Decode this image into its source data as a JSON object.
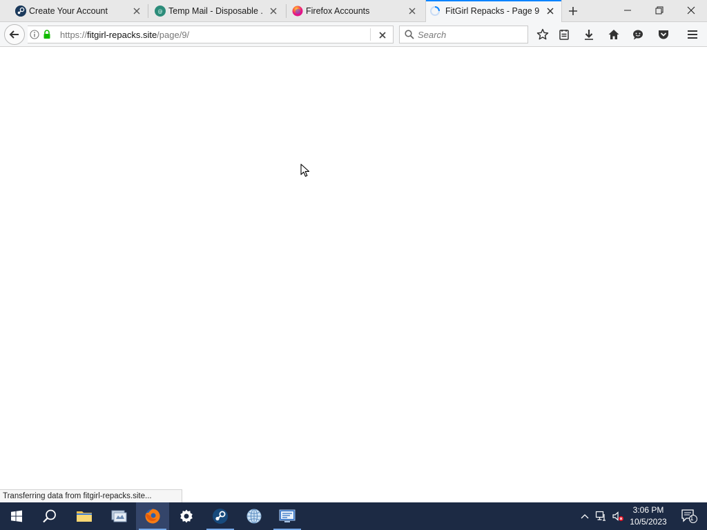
{
  "tabs": [
    {
      "title": "Create Your Account",
      "favicon": "steam-icon"
    },
    {
      "title": "Temp Mail - Disposable ...",
      "favicon": "tempmail-icon"
    },
    {
      "title": "Firefox Accounts",
      "favicon": "firefox-icon"
    },
    {
      "title": "FitGirl Repacks - Page 9 ...",
      "favicon": "loading-spinner-icon",
      "active": true
    }
  ],
  "address_bar": {
    "url_prefix": "https://",
    "url_host": "fitgirl-repacks.site",
    "url_path": "/page/9/"
  },
  "search_bar": {
    "placeholder": "Search",
    "value": ""
  },
  "status": {
    "text": "Transferring data from fitgirl-repacks.site..."
  },
  "taskbar": {
    "apps": [
      "start-icon",
      "search-icon",
      "file-explorer-icon",
      "system-app-icon",
      "firefox-icon",
      "settings-icon",
      "steam-icon",
      "globe-app-icon",
      "remote-app-icon"
    ],
    "clock_time": "3:06 PM",
    "clock_date": "10/5/2023",
    "notification_count": "1"
  },
  "colors": {
    "accent": "#0a84ff",
    "taskbar": "#1c2a44",
    "secure_lock": "#12bc00"
  }
}
